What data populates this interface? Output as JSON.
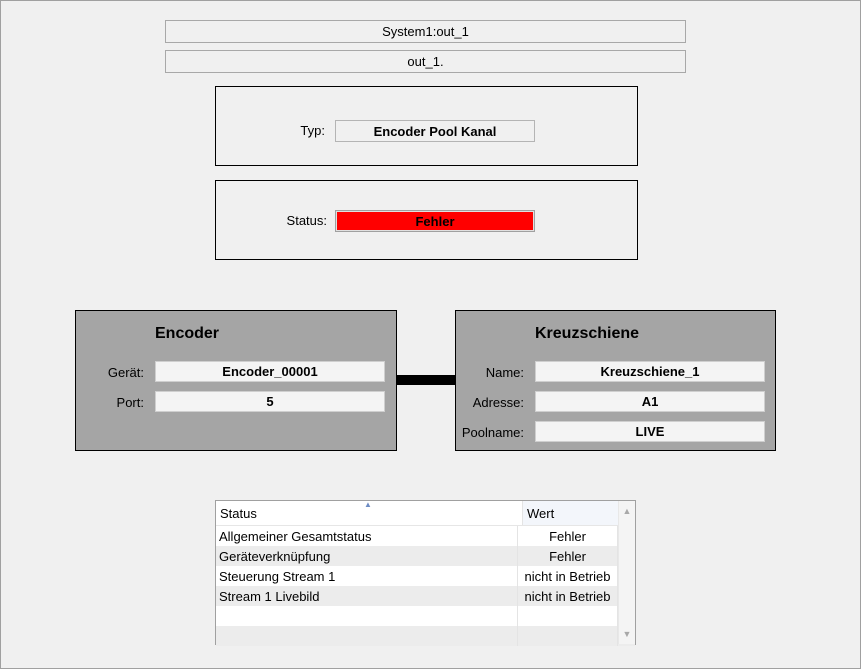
{
  "header": {
    "system_title": "System1:out_1",
    "channel_name": "out_1."
  },
  "type_group": {
    "label": "Typ:",
    "value": "Encoder Pool Kanal"
  },
  "status_group": {
    "label": "Status:",
    "value": "Fehler",
    "color": "#ff0000"
  },
  "encoder": {
    "title": "Encoder",
    "fields": [
      {
        "label": "Gerät:",
        "value": "Encoder_00001"
      },
      {
        "label": "Port:",
        "value": "5"
      }
    ]
  },
  "crossbar": {
    "title": "Kreuzschiene",
    "fields": [
      {
        "label": "Name:",
        "value": "Kreuzschiene_1"
      },
      {
        "label": "Adresse:",
        "value": "A1"
      },
      {
        "label": "Poolname:",
        "value": "LIVE"
      }
    ]
  },
  "status_table": {
    "columns": [
      "Status",
      "Wert"
    ],
    "rows": [
      [
        "Allgemeiner Gesamtstatus",
        "Fehler"
      ],
      [
        "Geräteverknüpfung",
        "Fehler"
      ],
      [
        "Steuerung Stream 1",
        "nicht in Betrieb"
      ],
      [
        "Stream 1 Livebild",
        "nicht in Betrieb"
      ]
    ]
  },
  "colors": {
    "background": "#f0f0f0",
    "node_fill": "#a5a5a5",
    "error": "#ff0000"
  }
}
